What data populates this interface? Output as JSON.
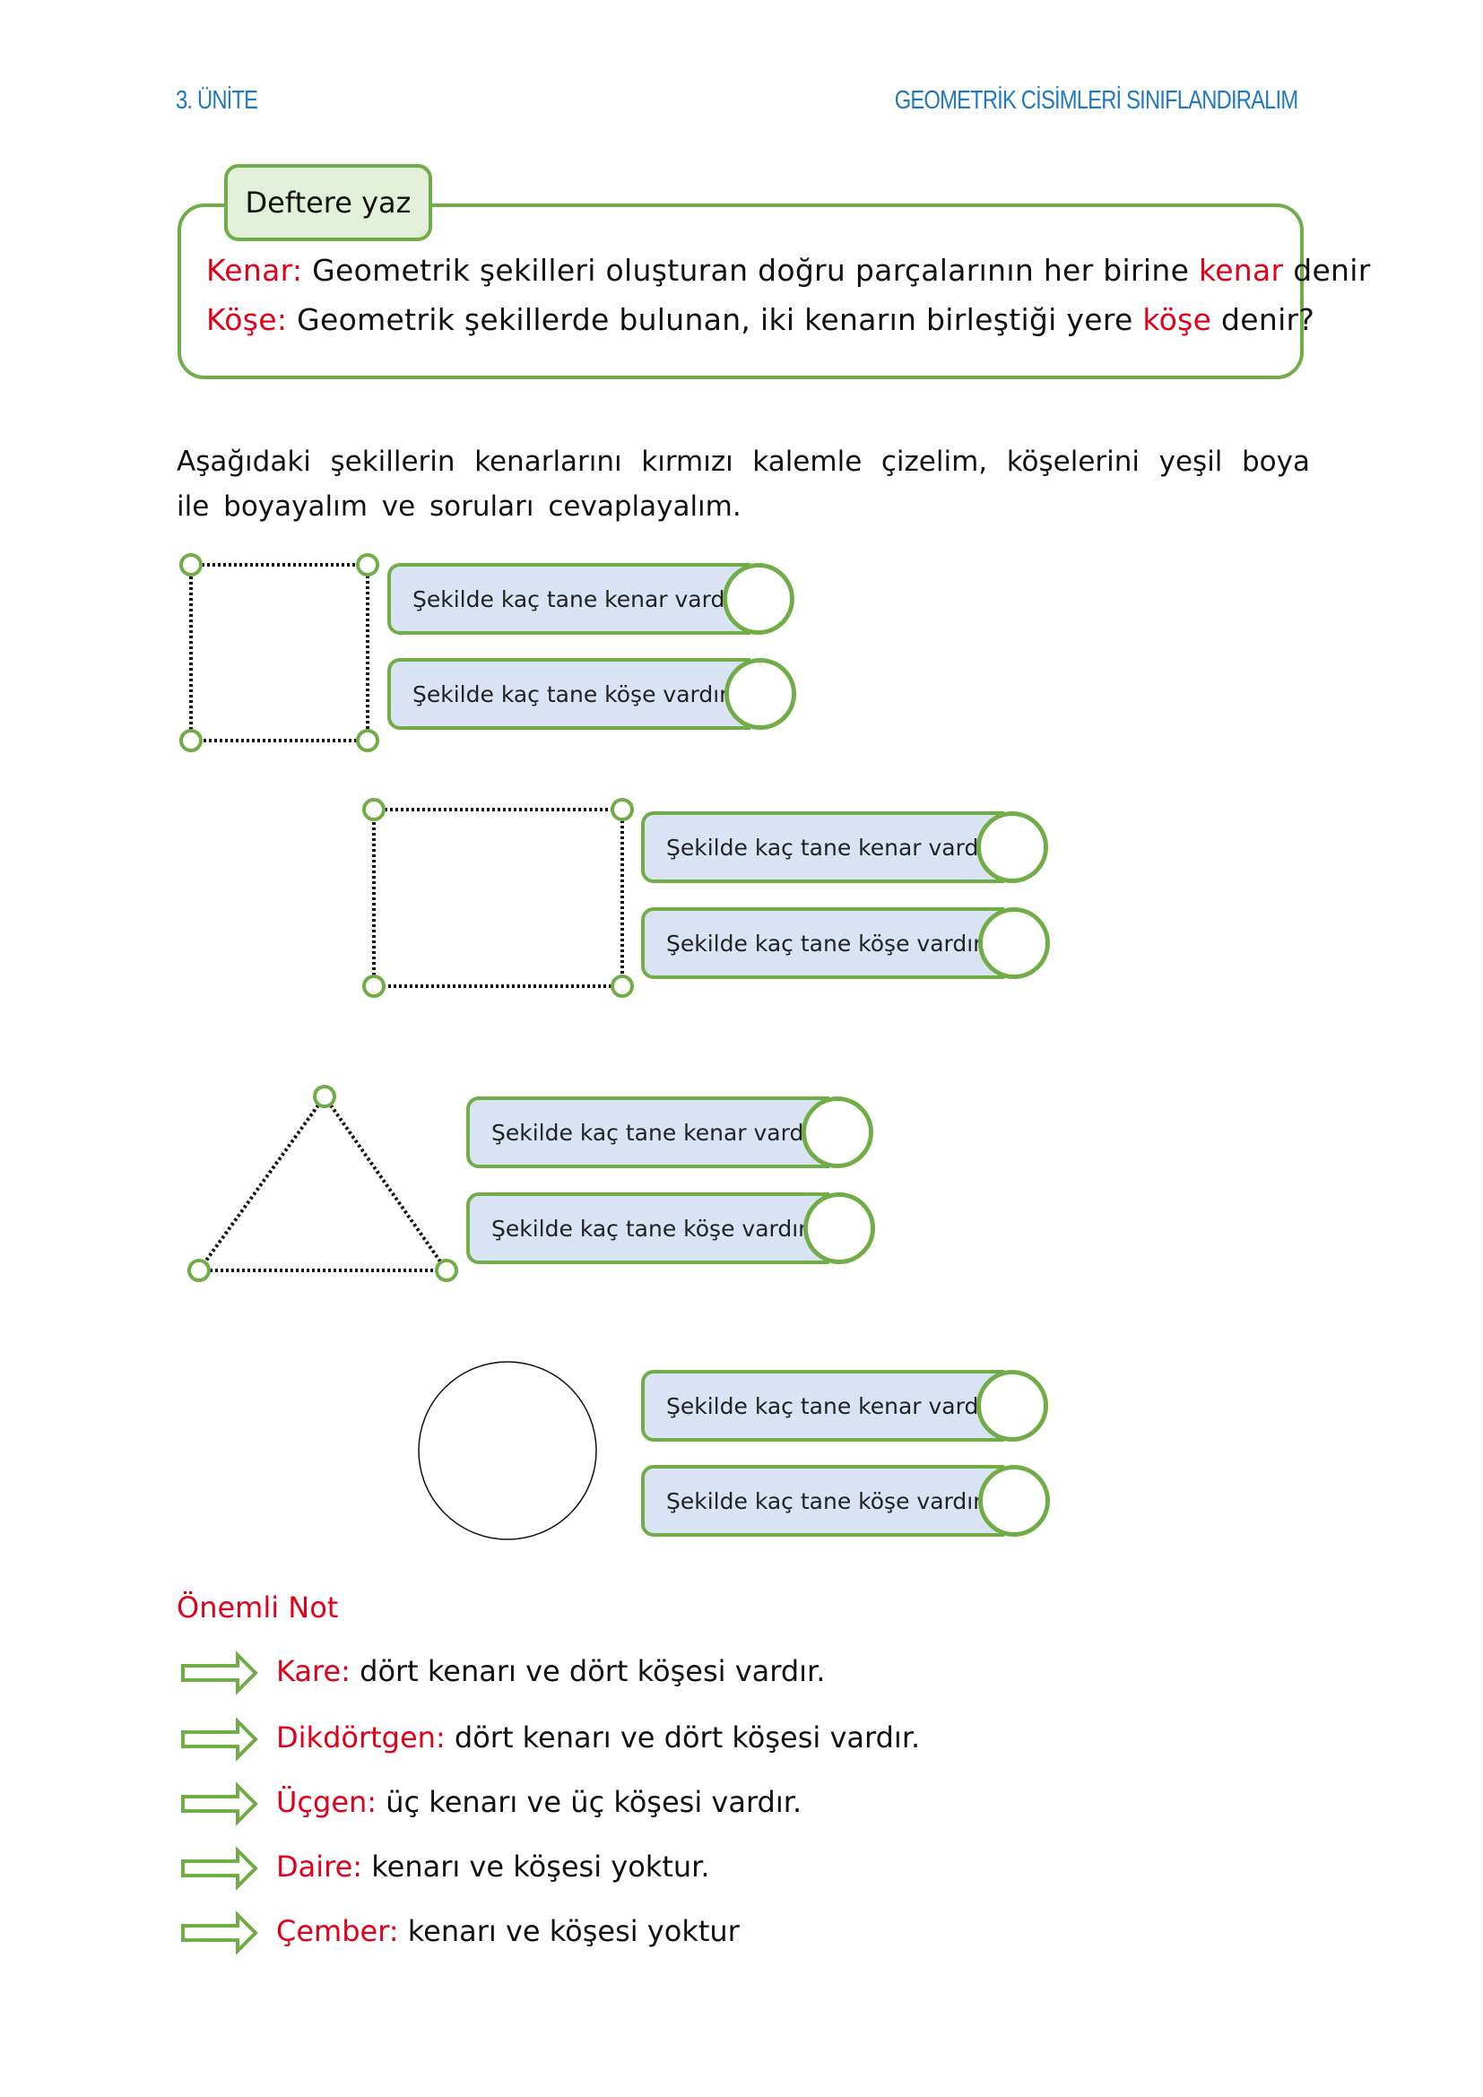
{
  "header": {
    "unit": "3. ÜNİTE",
    "topic": "GEOMETRİK CİSİMLERİ SINIFLANDIRALIM"
  },
  "definition_box": {
    "tab_label": "Deftere yaz",
    "lines": [
      {
        "term": "Kenar:",
        "text_before": " Geometrik şekilleri oluşturan doğru parçalarının her birine ",
        "highlight": "kenar",
        "text_after": " denir"
      },
      {
        "term": "Köşe:",
        "text_before": " Geometrik şekillerde bulunan, iki kenarın birleştiği yere ",
        "highlight": "köşe",
        "text_after": " denir?"
      }
    ]
  },
  "instruction": "Aşağıdaki şekillerin kenarlarını kırmızı kalemle çizelim, köşelerini yeşil boya ile boyayalım ve soruları cevaplayalım.",
  "exercises": [
    {
      "shape": "rectangle-tall",
      "questions": [
        "Şekilde kaç tane kenar vardır?",
        "Şekilde kaç tane köşe vardır?"
      ],
      "answers": [
        "",
        ""
      ]
    },
    {
      "shape": "square",
      "questions": [
        "Şekilde kaç tane kenar vardır?",
        "Şekilde kaç tane köşe vardır?"
      ],
      "answers": [
        "",
        ""
      ]
    },
    {
      "shape": "triangle",
      "questions": [
        "Şekilde kaç tane kenar vardır?",
        "Şekilde kaç tane köşe vardır?"
      ],
      "answers": [
        "",
        ""
      ]
    },
    {
      "shape": "circle",
      "questions": [
        "Şekilde kaç tane kenar vardır?",
        "Şekilde kaç tane köşe vardır?"
      ],
      "answers": [
        "",
        ""
      ]
    }
  ],
  "notes": {
    "title": "Önemli Not",
    "items": [
      {
        "term": "Kare:",
        "text": " dört kenarı ve dört köşesi vardır.",
        "icon": "arrow-right-icon"
      },
      {
        "term": "Dikdörtgen:",
        "text": " dört kenarı ve dört köşesi vardır.",
        "icon": "arrow-right-icon"
      },
      {
        "term": "Üçgen:",
        "text": " üç kenarı ve üç köşesi vardır.",
        "icon": "arrow-right-icon"
      },
      {
        "term": "Daire:",
        "text": " kenarı ve köşesi yoktur.",
        "icon": "arrow-right-icon"
      },
      {
        "term": "Çember:",
        "text": " kenarı ve köşesi yoktur",
        "icon": "arrow-right-icon"
      }
    ]
  },
  "colors": {
    "accent_green": "#70ad47",
    "tab_fill": "#e2efd9",
    "pill_fill": "#dae3f3",
    "header_blue": "#1f78c1",
    "term_red": "#e0001a"
  }
}
